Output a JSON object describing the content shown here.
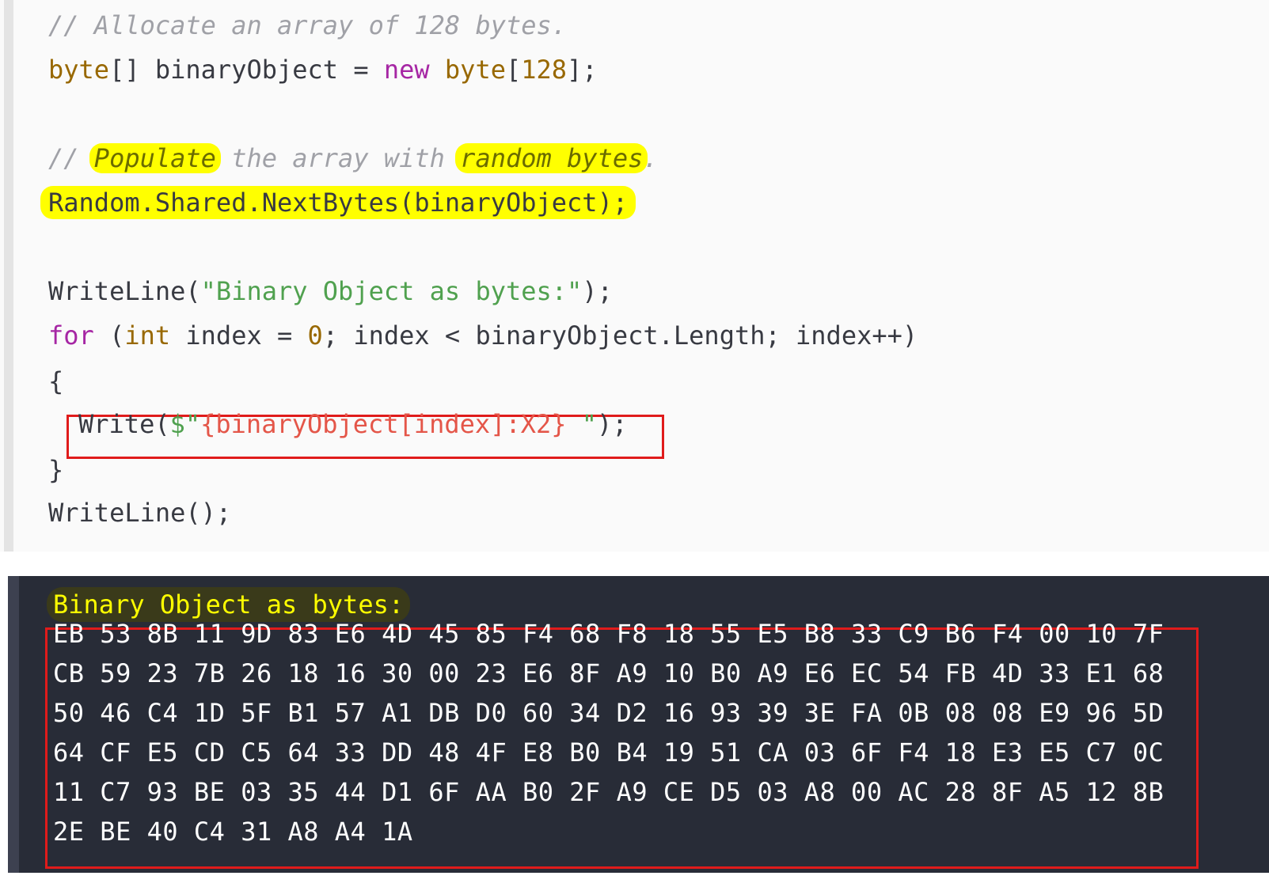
{
  "code": {
    "line1": "// Allocate an array of 128 bytes.",
    "line2": {
      "t1": "byte",
      "t2": "[] binaryObject = ",
      "t3": "new",
      "t4": " ",
      "t5": "byte",
      "t6": "[",
      "t7": "128",
      "t8": "];"
    },
    "line3": {
      "c1": "// ",
      "c2": "Populate",
      "c3": " the array with ",
      "c4": "random bytes",
      "c5": "."
    },
    "line4": "Random.Shared.NextBytes(binaryObject);",
    "line5": {
      "t1": "WriteLine(",
      "t2": "\"Binary Object as bytes:\"",
      "t3": ");"
    },
    "line6": {
      "t1": "for",
      "t2": " (",
      "t3": "int",
      "t4": " index = ",
      "t5": "0",
      "t6": "; index < binaryObject.Length; index++)"
    },
    "line7": "{",
    "line8": {
      "t1": "Write(",
      "t2": "$\"",
      "t3": "{binaryObject[index]:X2}",
      "t4": " \"",
      "t5": ");"
    },
    "line9": "}",
    "line10": "WriteLine();"
  },
  "console": {
    "title": "Binary Object as bytes:",
    "rows": [
      "EB 53 8B 11 9D 83 E6 4D 45 85 F4 68 F8 18 55 E5 B8 33 C9 B6 F4 00 10 7F",
      "CB 59 23 7B 26 18 16 30 00 23 E6 8F A9 10 B0 A9 E6 EC 54 FB 4D 33 E1 68",
      "50 46 C4 1D 5F B1 57 A1 DB D0 60 34 D2 16 93 39 3E FA 0B 08 08 E9 96 5D",
      "64 CF E5 CD C5 64 33 DD 48 4F E8 B0 B4 19 51 CA 03 6F F4 18 E3 E5 C7 0C",
      "11 C7 93 BE 03 35 44 D1 6F AA B0 2F A9 CE D5 03 A8 00 AC 28 8F A5 12 8B",
      "2E BE 40 C4 31 A8 A4 1A"
    ]
  },
  "colors": {
    "highlight": "#ffff00",
    "box_border": "#e01b1b",
    "console_bg": "#282c37"
  }
}
